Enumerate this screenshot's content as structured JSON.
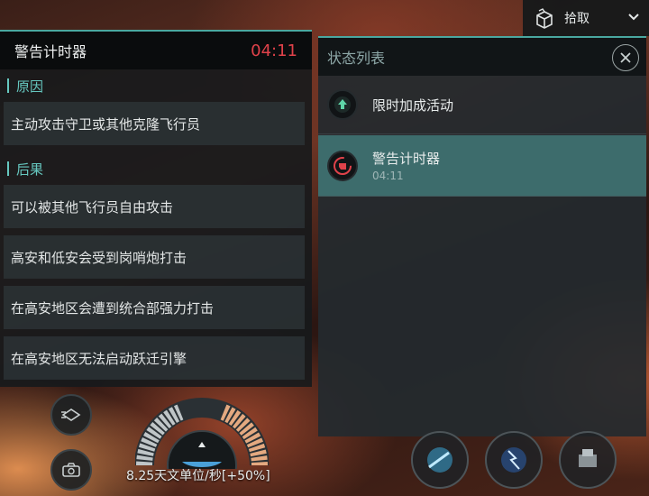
{
  "pickup": {
    "label": "拾取",
    "icon": "open-box-icon"
  },
  "warning_panel": {
    "title": "警告计时器",
    "timer": "04:11",
    "sections": [
      {
        "heading": "原因",
        "items": [
          "主动攻击守卫或其他克隆飞行员"
        ]
      },
      {
        "heading": "后果",
        "items": [
          "可以被其他飞行员自由攻击",
          "高安和低安会受到岗哨炮打击",
          "在高安地区会遭到统合部强力打击",
          "在高安地区无法启动跃迁引擎"
        ]
      }
    ]
  },
  "status_panel": {
    "title": "状态列表",
    "close_icon": "close-icon",
    "rows": [
      {
        "title": "限时加成活动",
        "subtitle": "",
        "icon": "up-arrow-icon"
      },
      {
        "title": "警告计时器",
        "subtitle": "04:11",
        "icon": "fist-icon"
      }
    ]
  },
  "hud": {
    "speed": "8.25天文单位/秒[+50%]"
  },
  "colors": {
    "accent": "#4aa8a0",
    "timer_red": "#e0424a",
    "section_teal": "#66c8c0",
    "active_row": "#3d6c6c"
  }
}
